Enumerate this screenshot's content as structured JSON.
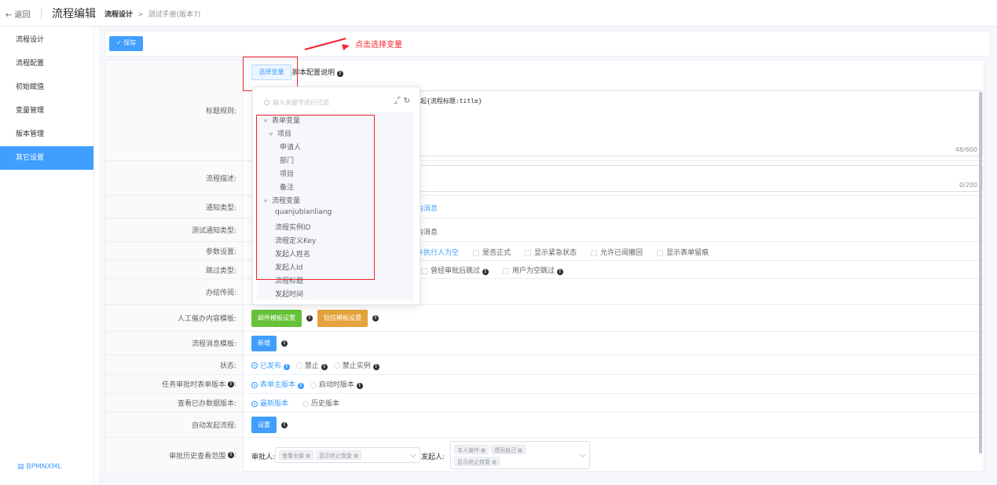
{
  "topbar": {
    "back_label": "返回",
    "app_title": "流程编辑",
    "breadcrumb_root": "流程设计",
    "breadcrumb_sep": ">",
    "breadcrumb_current": "测试手册(版本7)"
  },
  "sidebar": {
    "items": [
      {
        "label": "流程设计"
      },
      {
        "label": "流程配置"
      },
      {
        "label": "初始赋值"
      },
      {
        "label": "变量管理"
      },
      {
        "label": "版本管理"
      },
      {
        "label": "其它设置"
      }
    ],
    "active_index": 5,
    "bpmn_label": "BPMNXML"
  },
  "toolbar": {
    "save_label": "保存"
  },
  "annotation": {
    "text": "点击选择变量"
  },
  "form": {
    "select_var_label": "选择变量",
    "script_help": "脚本配置说明",
    "title_rule": {
      "label": "标题规则:",
      "text_visible": "起{流程标题:title}",
      "count": "48/600"
    },
    "desc": {
      "label": "流程描述:",
      "count": "0/200"
    },
    "notify": {
      "label": "通知类型:",
      "value_visible": "内消息"
    },
    "test_notify": {
      "label": "测试通知类型:",
      "value_visible": "内消息"
    },
    "params": {
      "label": "参数设置:",
      "first_visible": "许执行人为空",
      "options": [
        "是否正式",
        "显示紧急状态",
        "允许已阅撤回",
        "显示表单留痕"
      ]
    },
    "skip": {
      "label": "跳过类型:",
      "options": [
        "曾经审批后跳过",
        "用户为空跳过"
      ]
    },
    "circulate": {
      "label": "办结传阅:"
    },
    "urge": {
      "label": "人工催办内容模板:",
      "email_btn": "邮件模板设置",
      "sms_btn": "短信模板设置"
    },
    "msgtpl": {
      "label": "流程消息模板:",
      "add_btn": "新增"
    },
    "status": {
      "label": "状态:",
      "options": [
        "已发布",
        "禁止",
        "禁止实例"
      ],
      "selected": 0
    },
    "form_ver": {
      "label": "任务审批时表单版本",
      "options": [
        "表单主版本",
        "启动时版本"
      ],
      "selected": 0
    },
    "view_ver": {
      "label": "查看已办数据版本:",
      "options": [
        "最新版本",
        "历史版本"
      ],
      "selected": 0
    },
    "auto_start": {
      "label": "自动发起流程:",
      "btn": "设置"
    },
    "history": {
      "label": "审批历史查看范围",
      "approver_label": "审批人:",
      "approver_tags": [
        "查看全部",
        "显示终止恢复"
      ],
      "starter_label": "发起人:",
      "starter_tags": [
        "本人操作",
        "退回自己",
        "显示终止恢复"
      ]
    }
  },
  "dropdown": {
    "search_placeholder": "输入关键字进行过滤",
    "tree": {
      "form_vars": "表单变量",
      "project_group": "项目",
      "form_items": [
        "申请人",
        "部门",
        "项目",
        "备注"
      ],
      "process_vars": "流程变量",
      "process_items": [
        "quanjubianliang",
        "流程实例ID",
        "流程定义Key",
        "发起人姓名",
        "发起人Id",
        "流程标题",
        "发起时间"
      ]
    }
  },
  "colors": {
    "primary": "#409eff",
    "success": "#67c23a",
    "warning": "#e6a23c",
    "annotation": "#f5222d"
  }
}
